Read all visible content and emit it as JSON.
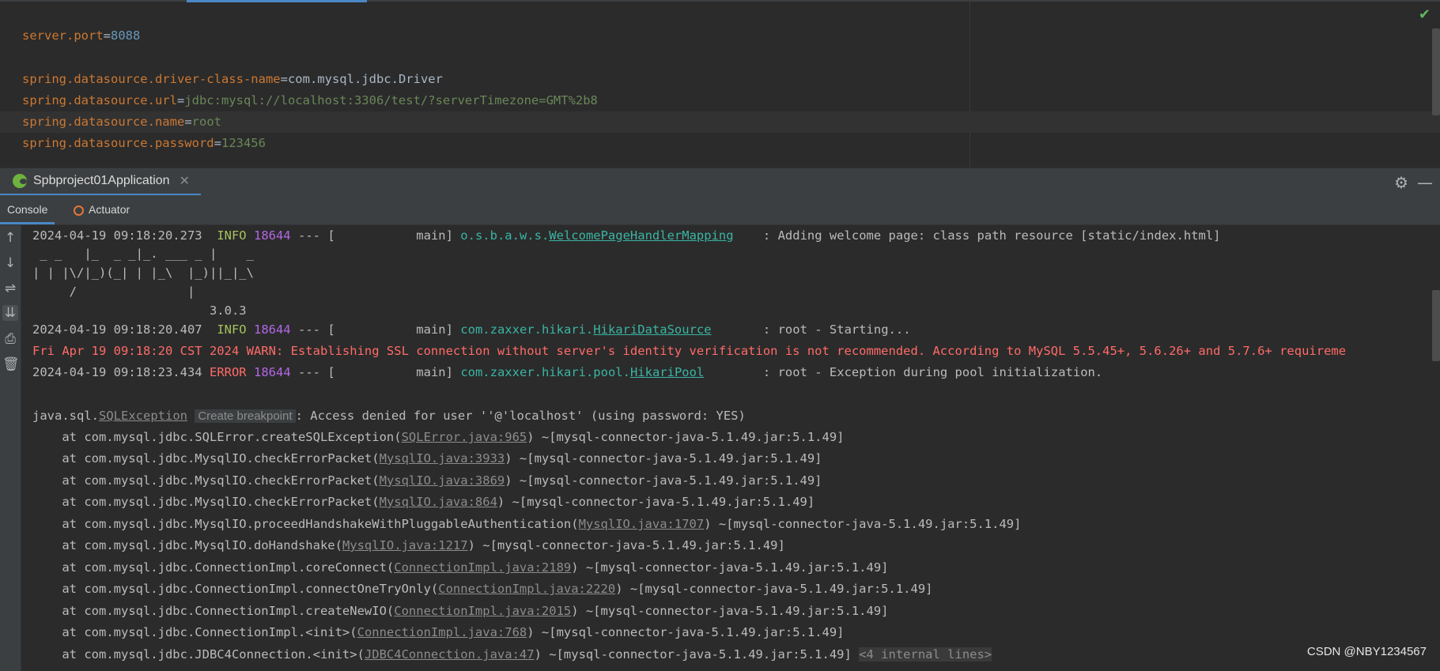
{
  "editor": {
    "lines": [
      {
        "key": "server.port",
        "value": "8088",
        "value_style": "number"
      },
      {
        "key": "spring.datasource.driver-class-name",
        "value": "com.mysql.jdbc.Driver",
        "value_style": "plain"
      },
      {
        "key": "spring.datasource.url",
        "value": "jdbc:mysql://localhost:3306/test/?serverTimezone=GMT%2b8",
        "value_style": "string"
      },
      {
        "key": "spring.datasource.name",
        "value": "root",
        "value_style": "string"
      },
      {
        "key": "spring.datasource.password",
        "value": "123456",
        "value_style": "string"
      }
    ],
    "status_icon": "check-icon",
    "status_color": "#5fb85f"
  },
  "run_window": {
    "tab_title": "Spbproject01Application",
    "tab_icon": "spring-boot-icon",
    "sub_tabs": [
      "Console",
      "Actuator"
    ],
    "header_icons": [
      "gear-icon",
      "minimize-icon"
    ],
    "left_toolbar_icons": [
      "arrow-up-icon",
      "arrow-down-icon",
      "soft-wrap-icon",
      "scroll-to-end-icon",
      "print-icon",
      "trash-icon"
    ]
  },
  "console": {
    "log1": {
      "ts": "2024-04-19 09:18:20.273",
      "level": "INFO",
      "pid": "18644",
      "sep": " --- [           main] ",
      "pkg": "o.s.b.a.w.s.",
      "cls": "WelcomePageHandlerMapping",
      "msg": "    : Adding welcome page: class path resource [static/index.html]"
    },
    "banner": [
      " _ _   |_  _ _|_. ___ _ |    _ ",
      "| | |\\/|_)(_| | |_\\  |_)||_|_\\ ",
      "     /               |",
      "                        3.0.3"
    ],
    "log2": {
      "ts": "2024-04-19 09:18:20.407",
      "level": "INFO",
      "pid": "18644",
      "sep": " --- [           main] ",
      "pkg": "com.zaxxer.hikari.",
      "cls": "HikariDataSource",
      "msg": "       : root - Starting..."
    },
    "warn": "Fri Apr 19 09:18:20 CST 2024 WARN: Establishing SSL connection without server's identity verification is not recommended. According to MySQL 5.5.45+, 5.6.26+ and 5.7.6+ requireme",
    "log3": {
      "ts": "2024-04-19 09:18:23.434",
      "level": "ERROR",
      "pid": "18644",
      "sep": " --- [           main] ",
      "pkg": "com.zaxxer.hikari.pool.",
      "cls": "HikariPool",
      "msg": "        : root - Exception during pool initialization."
    },
    "exception": {
      "prefix": "java.sql.",
      "cls": "SQLException",
      "breakpoint": "Create breakpoint",
      "msg": ": Access denied for user ''@'localhost' (using password: YES)"
    },
    "stack": [
      {
        "pre": "    at com.mysql.jdbc.SQLError.createSQLException(",
        "link": "SQLError.java:965",
        "post": ") ~[mysql-connector-java-5.1.49.jar:5.1.49]"
      },
      {
        "pre": "    at com.mysql.jdbc.MysqlIO.checkErrorPacket(",
        "link": "MysqlIO.java:3933",
        "post": ") ~[mysql-connector-java-5.1.49.jar:5.1.49]"
      },
      {
        "pre": "    at com.mysql.jdbc.MysqlIO.checkErrorPacket(",
        "link": "MysqlIO.java:3869",
        "post": ") ~[mysql-connector-java-5.1.49.jar:5.1.49]"
      },
      {
        "pre": "    at com.mysql.jdbc.MysqlIO.checkErrorPacket(",
        "link": "MysqlIO.java:864",
        "post": ") ~[mysql-connector-java-5.1.49.jar:5.1.49]"
      },
      {
        "pre": "    at com.mysql.jdbc.MysqlIO.proceedHandshakeWithPluggableAuthentication(",
        "link": "MysqlIO.java:1707",
        "post": ") ~[mysql-connector-java-5.1.49.jar:5.1.49]"
      },
      {
        "pre": "    at com.mysql.jdbc.MysqlIO.doHandshake(",
        "link": "MysqlIO.java:1217",
        "post": ") ~[mysql-connector-java-5.1.49.jar:5.1.49]"
      },
      {
        "pre": "    at com.mysql.jdbc.ConnectionImpl.coreConnect(",
        "link": "ConnectionImpl.java:2189",
        "post": ") ~[mysql-connector-java-5.1.49.jar:5.1.49]"
      },
      {
        "pre": "    at com.mysql.jdbc.ConnectionImpl.connectOneTryOnly(",
        "link": "ConnectionImpl.java:2220",
        "post": ") ~[mysql-connector-java-5.1.49.jar:5.1.49]"
      },
      {
        "pre": "    at com.mysql.jdbc.ConnectionImpl.createNewIO(",
        "link": "ConnectionImpl.java:2015",
        "post": ") ~[mysql-connector-java-5.1.49.jar:5.1.49]"
      },
      {
        "pre": "    at com.mysql.jdbc.ConnectionImpl.<init>(",
        "link": "ConnectionImpl.java:768",
        "post": ") ~[mysql-connector-java-5.1.49.jar:5.1.49]"
      },
      {
        "pre": "    at com.mysql.jdbc.JDBC4Connection.<init>(",
        "link": "JDBC4Connection.java:47",
        "post": ") ~[mysql-connector-java-5.1.49.jar:5.1.49] ",
        "internal": "<4 internal lines>"
      }
    ]
  },
  "watermark": "CSDN @NBY1234567"
}
